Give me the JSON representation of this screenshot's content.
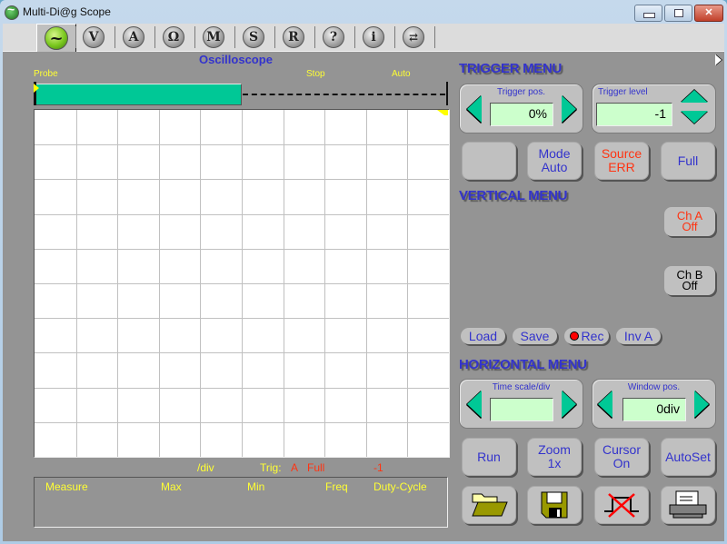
{
  "window": {
    "title": "Multi-Di@g Scope",
    "controls": {
      "minimize": "minimize",
      "maximize": "maximize",
      "close": "close"
    }
  },
  "toolbar": {
    "items": [
      {
        "id": "oscilloscope",
        "glyph": "~",
        "active": true
      },
      {
        "id": "voltmeter",
        "glyph": "V"
      },
      {
        "id": "ammeter",
        "glyph": "A"
      },
      {
        "id": "ohmmeter",
        "glyph": "Ω"
      },
      {
        "id": "multimeter",
        "glyph": "M"
      },
      {
        "id": "s-mode",
        "glyph": "S"
      },
      {
        "id": "r-mode",
        "glyph": "R"
      },
      {
        "id": "help",
        "glyph": "?"
      },
      {
        "id": "info",
        "glyph": "i"
      },
      {
        "id": "switch-window",
        "glyph": "⇄"
      }
    ]
  },
  "scope": {
    "title": "Oscilloscope",
    "probe_label": "Probe",
    "stop_label": "Stop",
    "auto_label": "Auto",
    "buffer_fill_fraction": 0.5,
    "grid": {
      "columns": 10,
      "rows": 10
    }
  },
  "status": {
    "div_label": "/div",
    "trig_label": "Trig:",
    "trig_source": "A",
    "trig_mode": "Full",
    "trig_level": "-1"
  },
  "measure": {
    "headers": [
      "Measure",
      "Max",
      "Min",
      "Freq",
      "Duty-Cycle"
    ]
  },
  "trigger_menu": {
    "title": "TRIGGER MENU",
    "pos_label": "Trigger pos.",
    "pos_value": "0%",
    "level_label": "Trigger level",
    "level_value": "-1",
    "blank_button": "",
    "mode_button": [
      "Mode",
      "Auto"
    ],
    "source_button": [
      "Source",
      "ERR"
    ],
    "full_button": "Full"
  },
  "vertical_menu": {
    "title": "VERTICAL MENU",
    "ch_a": [
      "Ch A",
      "Off"
    ],
    "ch_b": [
      "Ch B",
      "Off"
    ],
    "load": "Load",
    "save": "Save",
    "rec": "Rec",
    "inv_a": "Inv A"
  },
  "horizontal_menu": {
    "title": "HORIZONTAL MENU",
    "time_label": "Time scale/div",
    "time_value": "",
    "window_label": "Window pos.",
    "window_value": "0div",
    "run": "Run",
    "zoom": [
      "Zoom",
      "1x"
    ],
    "cursor": [
      "Cursor",
      "On"
    ],
    "autoset": "AutoSet"
  },
  "colors": {
    "accent_blue": "#3333cc",
    "label_yellow": "#ffff33",
    "alert_red": "#ff3311",
    "buffer_green": "#00c896",
    "field_green": "#ccffcc"
  }
}
